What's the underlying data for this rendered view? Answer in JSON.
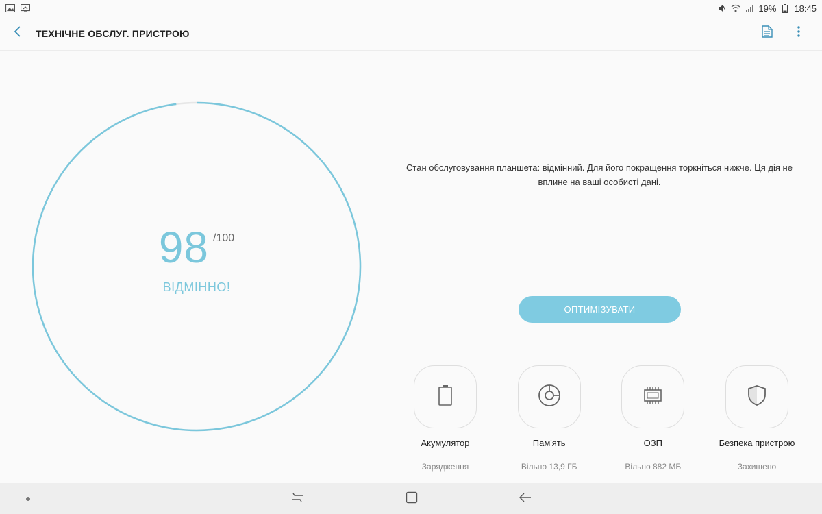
{
  "status_bar": {
    "battery_percent": "19%",
    "time": "18:45",
    "icons": [
      "gallery-icon",
      "cast-icon",
      "mute-icon",
      "wifi-icon",
      "signal-icon",
      "battery-icon"
    ]
  },
  "app_bar": {
    "title": "ТЕХНІЧНЕ ОБСЛУГ. ПРИСТРОЮ",
    "icons": [
      "back-arrow-icon",
      "document-icon",
      "more-vert-icon"
    ]
  },
  "score": {
    "value": "98",
    "max": "/100",
    "label": "ВІДМІННО!",
    "fraction": 0.98
  },
  "description": "Стан обслуговування планшета: відмінний. Для його покращення торкніться нижче. Ця дія не вплине на ваші особисті дані.",
  "optimize_button": "ОПТИМІЗУВАТИ",
  "categories": [
    {
      "title": "Акумулятор",
      "subtitle": "Зарядження",
      "icon": "battery-icon"
    },
    {
      "title": "Пам'ять",
      "subtitle": "Вільно 13,9 ГБ",
      "icon": "storage-icon"
    },
    {
      "title": "ОЗП",
      "subtitle": "Вільно 882 МБ",
      "icon": "ram-chip-icon"
    },
    {
      "title": "Безпека пристрою",
      "subtitle": "Захищено",
      "icon": "shield-icon"
    }
  ],
  "nav_bar": {
    "icons": [
      "recents-icon",
      "home-icon",
      "back-icon"
    ]
  },
  "colors": {
    "accent": "#7bc7dc",
    "button": "#7fcbe1",
    "ring_track": "#e6e6e6"
  }
}
